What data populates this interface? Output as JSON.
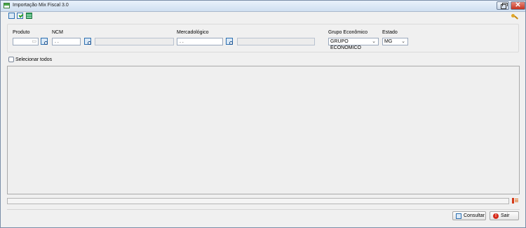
{
  "window": {
    "title": "Importação Mix Fiscal 3.0",
    "close_glyph": "✕"
  },
  "icons": [
    "window-app-icon",
    "consult-toolbar-icon",
    "approve-toolbar-icon",
    "spreadsheet-toolbar-icon",
    "key-icon",
    "search-lookup-icon",
    "status-list-icon",
    "exit-icon"
  ],
  "filters": {
    "produto": {
      "label": "Produto",
      "value": ""
    },
    "ncm": {
      "label": "NCM",
      "value": ". .",
      "description": ""
    },
    "mercadologico": {
      "label": "Mercadológico",
      "value": ". .",
      "description": ""
    },
    "grupo_economico": {
      "label": "Grupo Econômico",
      "selected": "GRUPO ECONOMICO"
    },
    "estado": {
      "label": "Estado",
      "selected": "MG"
    }
  },
  "select_all": {
    "label": "Selecionar todos",
    "checked": false
  },
  "buttons": {
    "consultar": "Consultar",
    "sair": "Sair",
    "sair_icon_glyph": "!"
  },
  "colors": {
    "close_button": "#c5331f",
    "exit_icon": "#d62a1a",
    "lookup_icon": "#2c6fb0"
  }
}
